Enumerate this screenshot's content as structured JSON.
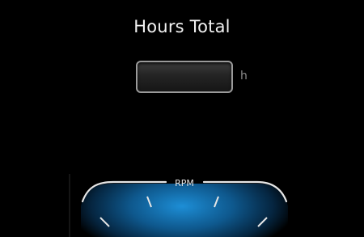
{
  "header": {
    "title": "Hours Total"
  },
  "hours": {
    "value": "",
    "unit": "h"
  },
  "gauge": {
    "label": "RPM",
    "glow_color": "#1a8fd6",
    "arc_color": "#e6e6e6"
  }
}
